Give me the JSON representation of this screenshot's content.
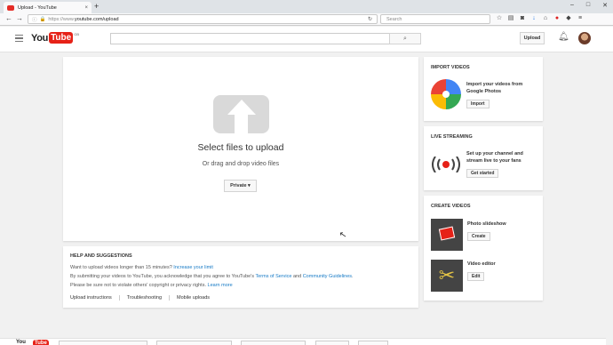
{
  "browser": {
    "tab_title": "Upload - YouTube",
    "tab_close": "×",
    "new_tab": "+",
    "window_controls": [
      "–",
      "□",
      "✕"
    ],
    "url_prefix": "https://www.",
    "url_main": "youtube.com/upload",
    "search_placeholder": "Search"
  },
  "youtube": {
    "logo_you": "You",
    "logo_tube": "Tube",
    "logo_region": "GB",
    "search_icon": "⌕",
    "upload_button": "Upload",
    "bell_icon": "🔔"
  },
  "upload": {
    "title": "Select files to upload",
    "subtitle": "Or drag and drop video files",
    "privacy_select": "Private ▾"
  },
  "help": {
    "heading": "HELP AND SUGGESTIONS",
    "line1_text": "Want to upload videos longer than 15 minutes?",
    "line1_link": "Increase your limit",
    "line2_text": "By submitting your videos to YouTube, you acknowledge that you agree to YouTube's",
    "line2_link1": "Terms of Service",
    "line2_and": "and",
    "line2_link2": "Community Guidelines",
    "line2_end": ".",
    "line3_text": "Please be sure not to violate others' copyright or privacy rights.",
    "line3_link": "Learn more",
    "links": [
      "Upload instructions",
      "Troubleshooting",
      "Mobile uploads"
    ]
  },
  "import_videos": {
    "title": "IMPORT VIDEOS",
    "description_line1": "Import your videos from",
    "description_line2": "Google Photos",
    "button": "Import"
  },
  "live_streaming": {
    "title": "LIVE STREAMING",
    "description_line1": "Set up your channel and",
    "description_line2": "stream live to your fans",
    "button": "Get started"
  },
  "create_videos": {
    "title": "CREATE VIDEOS",
    "slideshow_title": "Photo slideshow",
    "slideshow_button": "Create",
    "editor_title": "Video editor",
    "editor_button": "Edit"
  }
}
